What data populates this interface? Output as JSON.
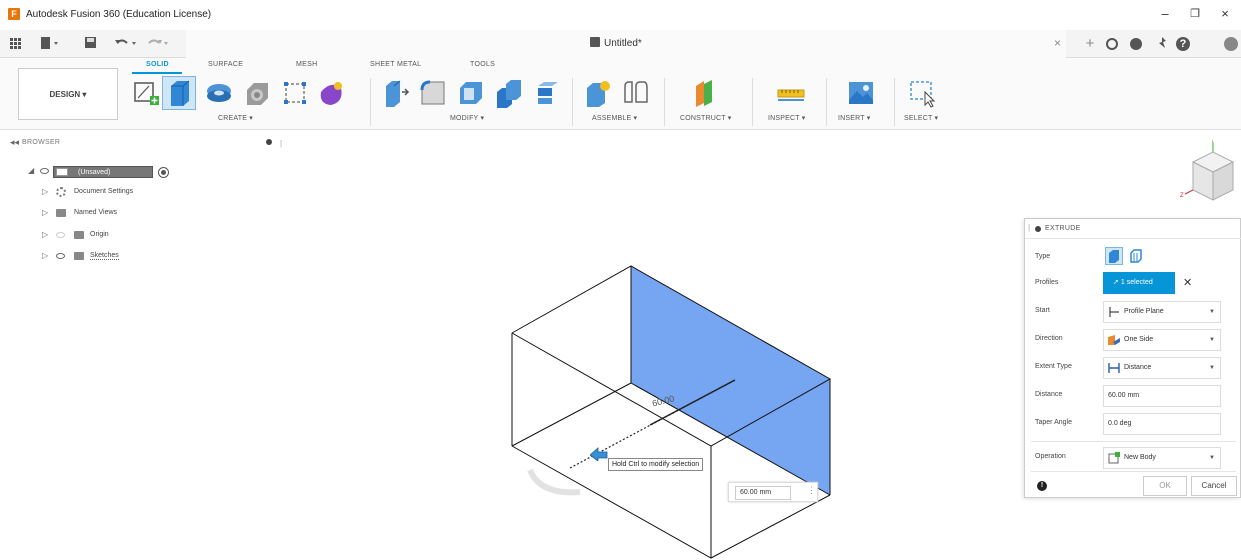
{
  "titlebar": {
    "app_title": "Autodesk Fusion 360 (Education License)",
    "app_icon_letter": "F",
    "minimize": "–",
    "maximize": "❐",
    "close": "×"
  },
  "quickbar": {
    "document_tab_title": "Untitled*",
    "tab_close": "×",
    "add_tab": "+",
    "help": "?"
  },
  "ribbon": {
    "design_button": "DESIGN ▾",
    "tabs": [
      "SOLID",
      "SURFACE",
      "MESH",
      "SHEET METAL",
      "TOOLS"
    ],
    "active_tab": "SOLID",
    "groups": [
      "CREATE ▾",
      "MODIFY ▾",
      "ASSEMBLE ▾",
      "CONSTRUCT ▾",
      "INSPECT ▾",
      "INSERT ▾",
      "SELECT ▾"
    ]
  },
  "browser": {
    "title": "BROWSER",
    "root_label": "(Unsaved)",
    "items": [
      {
        "label": "Document Settings",
        "icon": "gear-icon"
      },
      {
        "label": "Named Views",
        "icon": "folder-icon"
      },
      {
        "label": "Origin",
        "icon": "folder-icon"
      },
      {
        "label": "Sketches",
        "icon": "folder-icon"
      }
    ]
  },
  "viewport": {
    "tooltip": "Hold Ctrl to modify selection",
    "dimension_label": "60.00",
    "distance_input": "60.00 mm",
    "colors": {
      "profile_fill": "#6fa0f0",
      "selection_blue": "#0696d7"
    }
  },
  "extrude": {
    "title": "EXTRUDE",
    "labels": {
      "type": "Type",
      "profiles": "Profiles",
      "start": "Start",
      "direction": "Direction",
      "extent_type": "Extent Type",
      "distance": "Distance",
      "taper_angle": "Taper Angle",
      "operation": "Operation"
    },
    "profiles_value": "1 selected",
    "profiles_clear": "✕",
    "start_value": "Profile Plane",
    "direction_value": "One Side",
    "extent_type_value": "Distance",
    "distance_value": "60.00 mm",
    "taper_angle_value": "0.0 deg",
    "operation_value": "New Body",
    "ok": "OK",
    "cancel": "Cancel",
    "info": "!"
  }
}
